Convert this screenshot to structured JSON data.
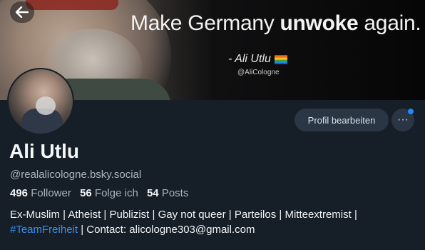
{
  "banner": {
    "quote_prefix": "Make Germany ",
    "quote_bold": "unwoke",
    "quote_suffix": " again.",
    "attribution": "- Ali Utlu",
    "attribution_handle": "@AliCologne"
  },
  "header": {
    "back_icon": "arrow-left-icon"
  },
  "actions": {
    "edit_profile_label": "Profil bearbeiten",
    "more_label": "···",
    "notification_color": "#1e88ff"
  },
  "profile": {
    "display_name": "Ali Utlu",
    "handle": "@realalicologne.bsky.social",
    "followers_count": "496",
    "followers_label": "Follower",
    "following_count": "56",
    "following_label": "Folge ich",
    "posts_count": "54",
    "posts_label": "Posts",
    "bio_line1": "Ex-Muslim | Atheist | Publizist | Gay not queer | Parteilos |  Mitteextremist |",
    "bio_hashtag": "#TeamFreiheit",
    "bio_line2_rest": " | Contact: alicologne303@gmail.com"
  },
  "colors": {
    "background": "#161e27",
    "accent": "#3b8ef0"
  }
}
